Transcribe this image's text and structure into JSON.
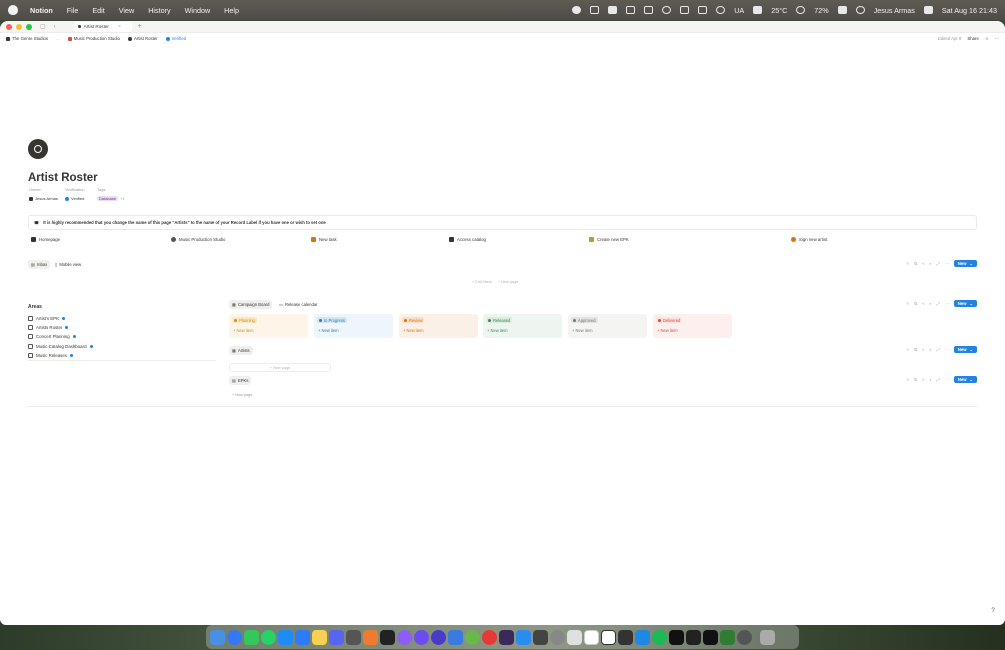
{
  "menubar": {
    "app": "Notion",
    "items": [
      "File",
      "Edit",
      "View",
      "History",
      "Window",
      "Help"
    ],
    "status": {
      "input": "UA",
      "weather": "25°C",
      "battery": "72%",
      "user": "Jesus Armas",
      "datetime": "Sat Aug 16  21:43"
    }
  },
  "tab": {
    "title": "Artist Roster"
  },
  "breadcrumb": {
    "workspace": "The Genre Studios",
    "ellipsis": "...",
    "studio": "Music Production Studio",
    "page": "Artist Roster",
    "verified": "Verified"
  },
  "topbar": {
    "edited": "Edited Apr 8",
    "share": "Share"
  },
  "page": {
    "title": "Artist Roster",
    "props": {
      "owner_label": "Owner",
      "verification_label": "Verification",
      "tags_label": "Tags",
      "owner": "Jesus Armas",
      "verification": "Verified",
      "tag": "Database",
      "tag_more": "+1"
    },
    "callout": "It is highly recommended that you change the name of this page \"Artists\" to the name of your Record Label if you have one or wish to set one",
    "links": [
      "Homepage",
      "Music Production Studio",
      "New task",
      "Access catalog",
      "Create new EPK",
      "Sign new artist"
    ]
  },
  "inbox": {
    "tabs": [
      "Inbox",
      "Mobile view"
    ],
    "hint_filters": "Edit filters",
    "hint_page": "New page"
  },
  "db": {
    "new_label": "New"
  },
  "areas": {
    "title": "Areas",
    "items": [
      "Artist's EPK",
      "Artists Roster",
      "Concert Planning",
      "Music Catalog Dashboard",
      "Music Releases"
    ]
  },
  "campaign": {
    "views": [
      "Campaign Board",
      "Release calendar"
    ],
    "columns": [
      {
        "name": "Planning",
        "color": "#cb912f",
        "bg": "#fdf6e8",
        "chip": "#fbe8c3"
      },
      {
        "name": "In Progress",
        "color": "#337ea9",
        "bg": "#eef5fb",
        "chip": "#d3e5f3"
      },
      {
        "name": "Review",
        "color": "#d9730d",
        "bg": "#fbf0e8",
        "chip": "#fadec9"
      },
      {
        "name": "Released",
        "color": "#448361",
        "bg": "#eef5f0",
        "chip": "#dbeddb"
      },
      {
        "name": "Approved",
        "color": "#787774",
        "bg": "#f4f4f3",
        "chip": "#e3e2e0"
      },
      {
        "name": "Delivered",
        "color": "#d44c47",
        "bg": "#fcefee",
        "chip": "#ffe2dd"
      }
    ],
    "new_item": "New item"
  },
  "artists": {
    "label": "Artists",
    "new_page": "New page"
  },
  "epks": {
    "label": "EPKs",
    "new_page": "New page"
  }
}
